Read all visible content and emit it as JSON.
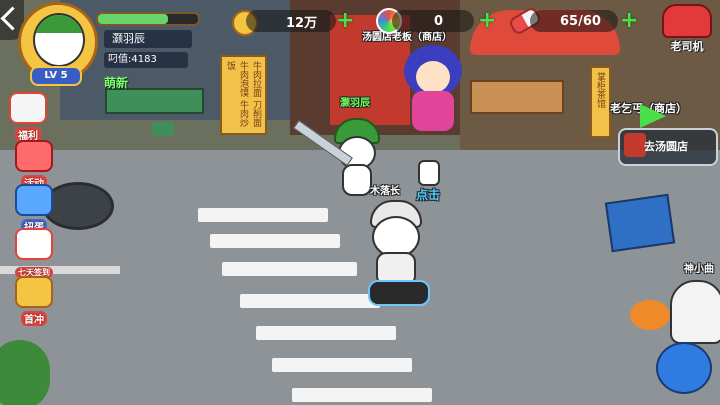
{
  "player": {
    "name": "灏羽辰",
    "level": "LV 5",
    "stat_label": "叼值:4183",
    "tag": "萌新"
  },
  "resources": {
    "gold": "12万",
    "candy": "0",
    "stamina": "65/60"
  },
  "npc": {
    "shop_owner": "汤圆店老板（商店）",
    "player_nameplate": "灏羽辰",
    "village_chief": "木落长",
    "old_beggar": "老乞丐（商店）",
    "god_xiaoqu": "神小曲",
    "click_hint": "点击"
  },
  "menu": {
    "welfare": "福利",
    "activity": "活动",
    "gacha": "扭蛋",
    "seven_day": "七天签到",
    "first_charge": "首冲",
    "driver": "老司机",
    "goto_shop": "去汤圆店"
  },
  "signs": {
    "noodle": "牛肉拉面 刀削面 牛肉泡馍 牛肉炒饭",
    "tea": "掌柜茶馆"
  },
  "colors": {
    "accent_green": "#49e04a",
    "badge_red": "#e2443a",
    "gold": "#f4c542"
  }
}
